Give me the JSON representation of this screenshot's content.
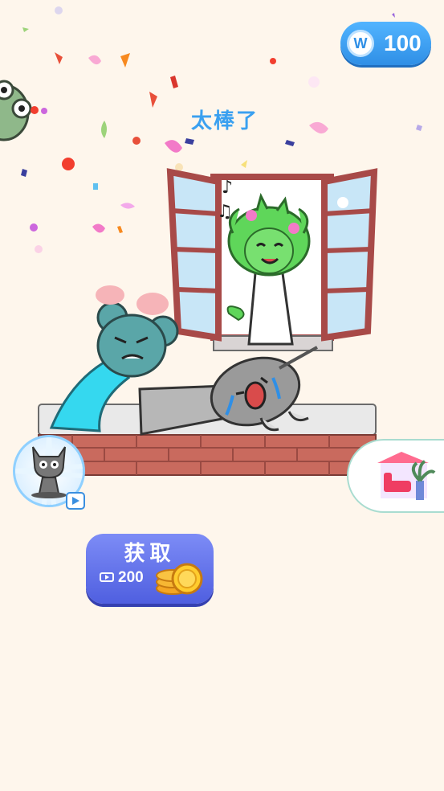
{
  "currency": {
    "icon": "w-coin-icon",
    "badge_letter": "W",
    "amount": "100"
  },
  "praise_text": "太棒了",
  "characters": [
    "green-frog-character",
    "angry-mouse-character",
    "green-haired-girl-character",
    "crying-gray-character"
  ],
  "hint_button": {
    "icon": "gray-cat-hint-icon",
    "badge_icon": "play-video-icon"
  },
  "room_button": {
    "icon": "room-furniture-icon"
  },
  "get_button": {
    "label": "获取",
    "cost": "200",
    "ad_icon": "video-ad-icon",
    "reward_icon": "gold-coins-icon"
  },
  "colors": {
    "background": "#fef6ec",
    "accent_blue": "#3aa0f0",
    "button_purple": "#5f6fe8",
    "brick": "#c96a5e",
    "window_frame": "#a84a48"
  }
}
